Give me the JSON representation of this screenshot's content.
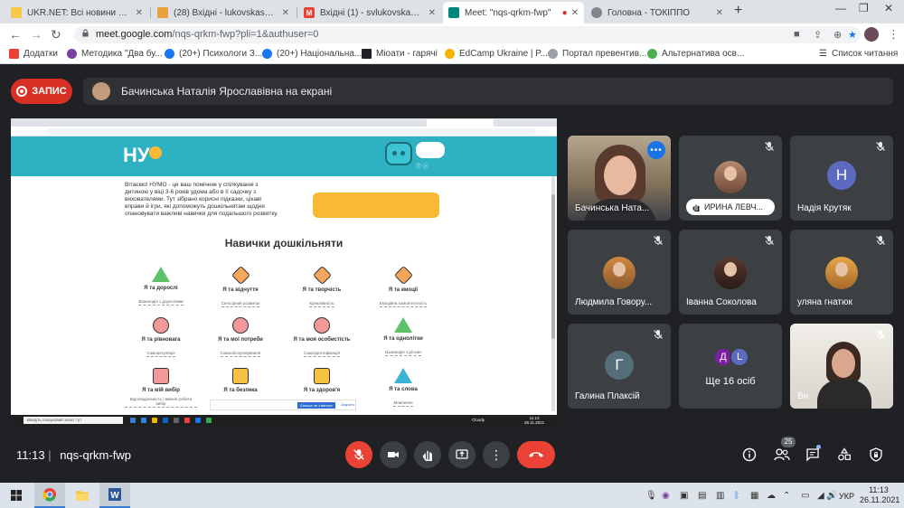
{
  "browser": {
    "tabs": [
      {
        "title": "UKR.NET: Всі новини Україн",
        "favicon_color": "#f7c948"
      },
      {
        "title": "(28) Вхідні - lukovskaso@ukr",
        "favicon_color": "#e9a23b"
      },
      {
        "title": "Вхідні (1) - svlukovska@gma",
        "favicon_color": "#ea4335"
      },
      {
        "title": "Meet: \"nqs-qrkm-fwp\"",
        "favicon_color": "#00897b"
      },
      {
        "title": "Головна - ТОКІППО",
        "favicon_color": "#80868b"
      }
    ],
    "url_host": "meet.google.com",
    "url_path": "/nqs-qrkm-fwp?pli=1&authuser=0",
    "bookmarks": [
      {
        "label": "Додатки",
        "color": "#5f6368"
      },
      {
        "label": "Методика \"Два бу...",
        "color": "#7b3fa0"
      },
      {
        "label": "(20+) Психологи З...",
        "color": "#1877f2"
      },
      {
        "label": "(20+) Національна...",
        "color": "#1877f2"
      },
      {
        "label": "Міоати - гарячі",
        "color": "#202124"
      },
      {
        "label": "EdCamp Ukraine | P...",
        "color": "#f4b400"
      },
      {
        "label": "Портал превентив...",
        "color": "#5f6368"
      },
      {
        "label": "Альтернатива осв...",
        "color": "#4caf50"
      }
    ],
    "reading_list": "Список читання"
  },
  "meet": {
    "record_label": "ЗАПИС",
    "presenter_text": "Бачинська Наталія Ярославівна на екрані",
    "time": "11:13",
    "meeting_code": "nqs-qrkm-fwp",
    "participant_count": "25",
    "participants": [
      {
        "name": "Бачинська Ната...",
        "kind": "video"
      },
      {
        "name": "ИРИНА ЛЕВЧ...",
        "kind": "photo"
      },
      {
        "name": "Надія Крутяк",
        "kind": "letter",
        "letter": "Н",
        "color": "#5c6bc0"
      },
      {
        "name": "Людмила Говору...",
        "kind": "photo"
      },
      {
        "name": "Іванна Соколова",
        "kind": "photo"
      },
      {
        "name": "уляна гнатюк",
        "kind": "photo"
      },
      {
        "name": "Галина Плаксій",
        "kind": "letter",
        "letter": "Г",
        "color": "#546e7a"
      },
      {
        "name": "Ще 16 осіб",
        "kind": "more",
        "letters": [
          "Д",
          "L"
        ],
        "colors": [
          "#7b1fa2",
          "#5c6bc0"
        ]
      },
      {
        "name": "Ви",
        "kind": "video"
      }
    ]
  },
  "shared": {
    "intro": "Вітаємо! НУМО - це ваш помічник у спілкуванні з дитиною у віці 3-6 років удома або в її садочку з вихователями. Тут зібрано корисні підказки, цікаві вправи й ігри, які допоможуть дошкільнятам щодня опановувати важливі навички для подальшого розвитку.",
    "title": "Навички дошкільняти",
    "skills": [
      {
        "name": "Я та дорослі",
        "sub": "Взаємодія з дорослими",
        "shape": "triangle",
        "color": "#5ec26a"
      },
      {
        "name": "Я та відчуття",
        "sub": "Сенсорний розвиток",
        "shape": "diamond",
        "color": "#f5a65b"
      },
      {
        "name": "Я та творчість",
        "sub": "Креативність",
        "shape": "diamond",
        "color": "#f5a65b"
      },
      {
        "name": "Я та емоції",
        "sub": "Емоційна компетентність",
        "shape": "diamond",
        "color": "#f5a65b"
      },
      {
        "name": "Я та рівновага",
        "sub": "Саморегуляція",
        "shape": "circle",
        "color": "#f29a9a"
      },
      {
        "name": "Я та мої потреби",
        "sub": "Самообслуговування",
        "shape": "circle",
        "color": "#f29a9a"
      },
      {
        "name": "Я та моя особистість",
        "sub": "Самоідентифікація",
        "shape": "circle",
        "color": "#f29a9a"
      },
      {
        "name": "Я та однолітки",
        "sub": "Взаємодія з дітьми",
        "shape": "triangle",
        "color": "#5ec26a"
      },
      {
        "name": "Я та мій вибір",
        "sub": "Відповідальність і вміння робити вибір",
        "shape": "square",
        "color": "#f29a9a"
      },
      {
        "name": "Я та безпека",
        "sub": "",
        "shape": "square",
        "color": "#f5c242"
      },
      {
        "name": "Я та здоров'я",
        "sub": "",
        "shape": "square",
        "color": "#f5c242"
      },
      {
        "name": "Я та слова",
        "sub": "Мовлення",
        "shape": "triangle",
        "color": "#3bb3d4"
      }
    ],
    "cookie_btn": "Більше не з'являти",
    "cookie_close": "Закрити",
    "taskbar_search": "Введіть пошуковий запит тут",
    "taskbar_weather": "Cloudy",
    "taskbar_time": "11:13",
    "taskbar_date": "26.11.2021"
  },
  "taskbar": {
    "lang": "УКР",
    "time": "11:13",
    "date": "26.11.2021"
  }
}
